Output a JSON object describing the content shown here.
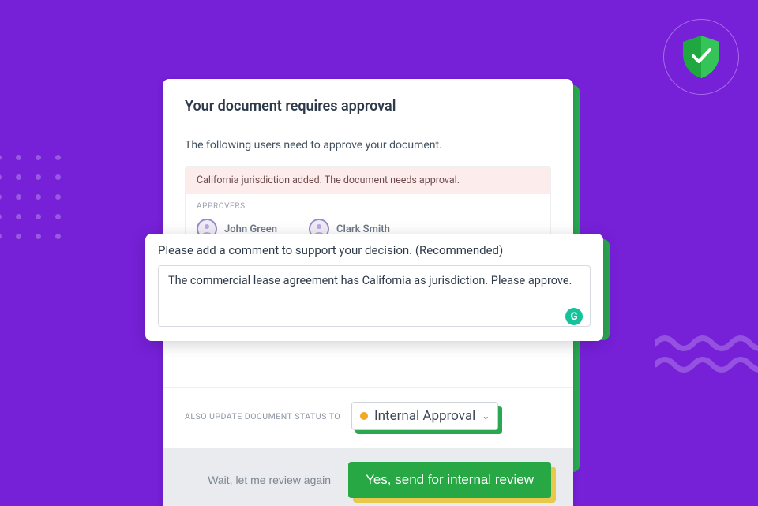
{
  "card": {
    "title": "Your document requires approval",
    "subtitle": "The following users need to approve your document.",
    "alert": "California jurisdiction added. The document needs approval.",
    "approvers_label": "APPROVERS",
    "approvers": [
      {
        "name": "John Green"
      },
      {
        "name": "Clark Smith"
      }
    ]
  },
  "comment": {
    "label": "Please add a comment to support your decision. (Recommended)",
    "value": "The commercial lease agreement has California as jurisdiction. Please approve."
  },
  "status": {
    "label": "ALSO UPDATE DOCUMENT STATUS TO",
    "selected": "Internal Approval",
    "dot_color": "#f5a623"
  },
  "footer": {
    "secondary": "Wait, let me review again",
    "primary": "Yes, send for internal review"
  },
  "grammarly_glyph": "G"
}
